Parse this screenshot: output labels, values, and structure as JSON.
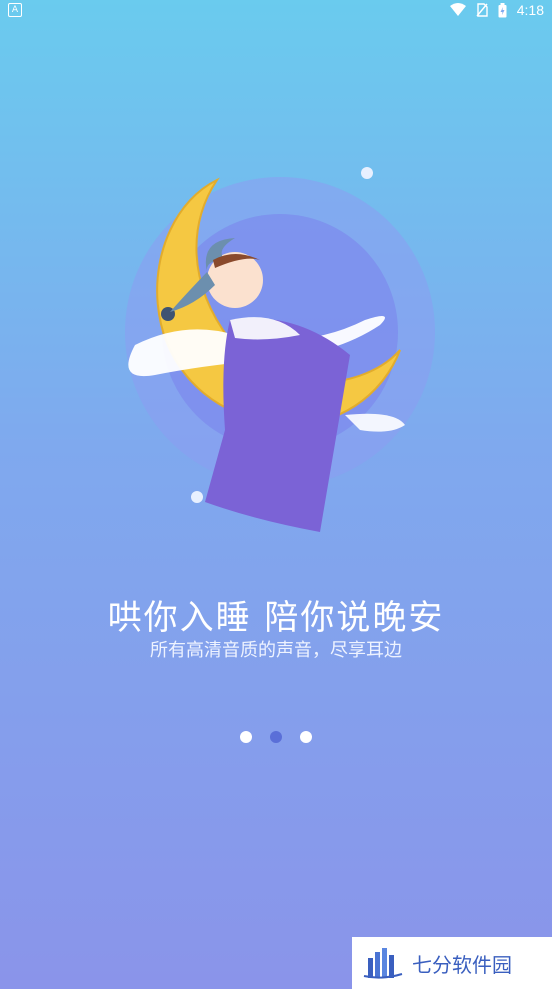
{
  "status_bar": {
    "time": "4:18",
    "icons": [
      "wifi-icon",
      "sim-off-icon",
      "battery-charging-icon"
    ]
  },
  "onboarding": {
    "title": "哄你入睡 陪你说晚安",
    "subtitle": "所有高清音质的声音，尽享耳边",
    "page_indicator": {
      "count": 3,
      "active_index": 1
    }
  },
  "watermark": {
    "text": "七分软件园"
  },
  "colors": {
    "bg_top": "#6acbee",
    "bg_bottom": "#8a94ea",
    "moon": "#f5c842",
    "blanket": "#7b63d6",
    "active_dot": "#5a6fd8"
  }
}
